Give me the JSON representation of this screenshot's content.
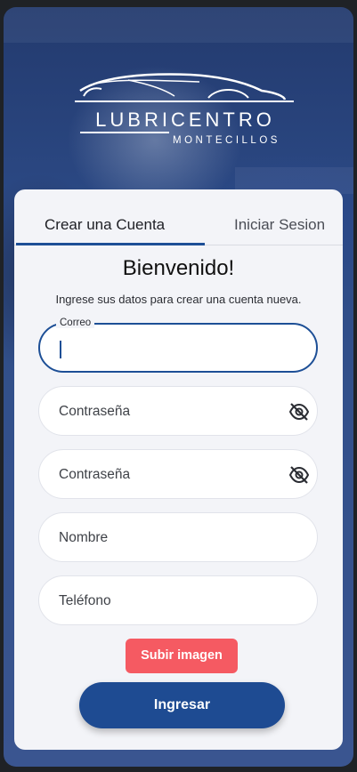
{
  "brand": {
    "name": "LUBRICENTRO",
    "subtitle": "MONTECILLOS"
  },
  "tabs": [
    {
      "label": "Crear una Cuenta",
      "active": true
    },
    {
      "label": "Iniciar Sesion",
      "active": false
    }
  ],
  "heading": "Bienvenido!",
  "subheading": "Ingrese sus datos para crear una cuenta nueva.",
  "form": {
    "email": {
      "label": "Correo",
      "value": ""
    },
    "password": {
      "placeholder": "Contraseña",
      "icon": "eye-off-icon"
    },
    "confirm_password": {
      "placeholder": "Contraseña",
      "icon": "eye-off-icon"
    },
    "name": {
      "placeholder": "Nombre"
    },
    "phone": {
      "placeholder": "Teléfono"
    }
  },
  "buttons": {
    "upload": "Subir imagen",
    "submit": "Ingresar"
  },
  "colors": {
    "primary": "#1e4b92",
    "accent": "#f55a62",
    "card": "#f3f4f8"
  }
}
